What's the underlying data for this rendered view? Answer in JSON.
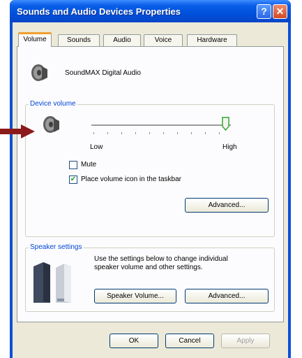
{
  "window": {
    "title": "Sounds and Audio Devices Properties",
    "help_label": "?",
    "close_label": "✕"
  },
  "tabs": [
    {
      "label": "Volume",
      "active": true
    },
    {
      "label": "Sounds"
    },
    {
      "label": "Audio"
    },
    {
      "label": "Voice"
    },
    {
      "label": "Hardware"
    }
  ],
  "device": {
    "name": "SoundMAX Digital Audio",
    "icon": "speaker-icon"
  },
  "device_volume": {
    "group_label": "Device volume",
    "low_label": "Low",
    "high_label": "High",
    "level": 1.0,
    "mute_label": "Mute",
    "mute_checked": false,
    "taskbar_label": "Place volume icon in the taskbar",
    "taskbar_checked": true,
    "advanced_label": "Advanced..."
  },
  "speaker_settings": {
    "group_label": "Speaker settings",
    "description_line1": "Use the settings below to change individual",
    "description_line2": "speaker volume and other settings.",
    "speaker_volume_label": "Speaker Volume...",
    "advanced_label": "Advanced..."
  },
  "footer": {
    "ok_label": "OK",
    "cancel_label": "Cancel",
    "apply_label": "Apply"
  },
  "colors": {
    "titlebar": "#0a5ee8",
    "group_label": "#0046d5",
    "arrow": "#8b1a1a",
    "face": "#ece9d8"
  }
}
